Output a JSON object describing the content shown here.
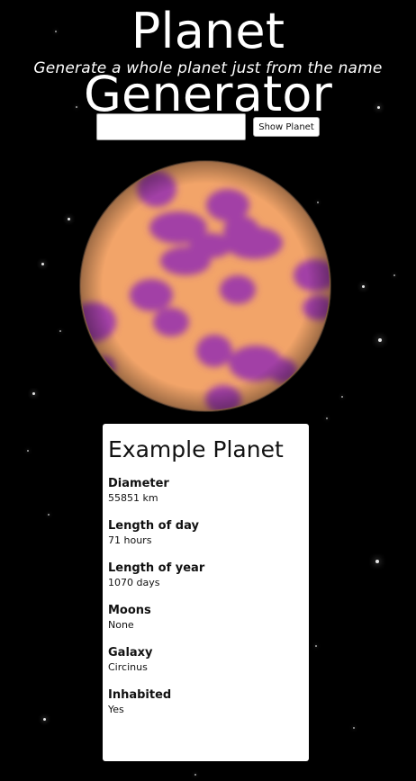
{
  "header": {
    "title": "Planet Generator",
    "subtitle": "Generate a whole planet just from the name"
  },
  "form": {
    "input_value": "",
    "input_placeholder": "",
    "button_label": "Show Planet"
  },
  "planet": {
    "base_color": "#f2a469",
    "spot_color": "#a23fa6",
    "rim_color": "#6b4d3a"
  },
  "card": {
    "title": "Example Planet",
    "stats": [
      {
        "label": "Diameter",
        "value": "55851 km"
      },
      {
        "label": "Length of day",
        "value": "71 hours"
      },
      {
        "label": "Length of year",
        "value": "1070 days"
      },
      {
        "label": "Moons",
        "value": "None"
      },
      {
        "label": "Galaxy",
        "value": "Circinus"
      },
      {
        "label": "Inhabited",
        "value": "Yes"
      }
    ]
  },
  "colors": {
    "background": "#000000",
    "text": "#ffffff",
    "card_background": "#ffffff"
  }
}
